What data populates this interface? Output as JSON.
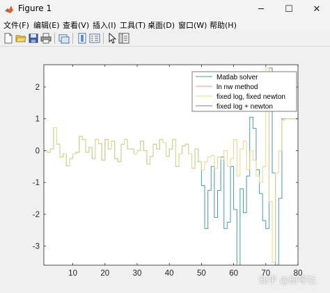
{
  "window": {
    "title": "Figure 1",
    "controls": {
      "minimize": "─",
      "maximize": "☐",
      "close": "✕"
    }
  },
  "menu": [
    {
      "label": "文件(F)"
    },
    {
      "label": "编辑(E)"
    },
    {
      "label": "查看(V)"
    },
    {
      "label": "插入(I)"
    },
    {
      "label": "工具(T)"
    },
    {
      "label": "桌面(D)"
    },
    {
      "label": "窗口(W)"
    },
    {
      "label": "帮助(H)"
    }
  ],
  "toolbar": {
    "icons": [
      "new-figure-icon",
      "open-file-icon",
      "save-icon",
      "print-icon",
      "link-plot-icon",
      "insert-colorbar-icon",
      "insert-legend-icon",
      "edit-plot-icon",
      "property-editor-icon"
    ]
  },
  "colors": {
    "matlab_solver": "#4a9aa8",
    "ln_nw": "#e89a76",
    "fixed_log_fixed_newton": "#e3d98a",
    "fixed_log_newton": "#808080"
  },
  "watermark": "知乎 @研导社",
  "chart_data": {
    "type": "line",
    "style": "stairs",
    "xlim": [
      1,
      80
    ],
    "ylim": [
      -3.6,
      2.7
    ],
    "xticks": [
      10,
      20,
      30,
      40,
      50,
      60,
      70,
      80
    ],
    "yticks": [
      2,
      1,
      0,
      -1,
      -2,
      -3
    ],
    "grid": false,
    "legend_position": "top-right",
    "series": [
      {
        "name": "Matlab solver",
        "color": "#4a9aa8",
        "x": [
          1,
          2,
          3,
          4,
          5,
          6,
          7,
          8,
          9,
          10,
          11,
          12,
          13,
          14,
          15,
          16,
          17,
          18,
          19,
          20,
          21,
          22,
          23,
          24,
          25,
          26,
          27,
          28,
          29,
          30,
          31,
          32,
          33,
          34,
          35,
          36,
          37,
          38,
          39,
          40,
          41,
          42,
          43,
          44,
          45,
          46,
          47,
          48,
          49,
          50,
          51,
          52,
          53,
          54,
          55,
          56,
          57,
          58,
          59,
          60,
          61,
          62,
          63,
          64,
          65,
          66,
          67,
          68,
          69,
          70,
          71,
          72,
          73,
          74,
          75,
          76,
          77,
          78,
          79,
          80
        ],
        "y": [
          0.0,
          -0.05,
          0.05,
          0.72,
          0.2,
          -0.2,
          -0.1,
          -0.48,
          -0.25,
          -0.1,
          -0.05,
          0.45,
          0.35,
          -0.05,
          0.1,
          -0.25,
          0.35,
          0.22,
          -0.3,
          0.35,
          0.05,
          0.3,
          -0.25,
          -0.35,
          0.2,
          0.35,
          0.05,
          0.05,
          -0.1,
          0.0,
          0.3,
          0.0,
          -0.42,
          -0.18,
          0.2,
          0.05,
          0.35,
          0.25,
          -0.18,
          0.05,
          0.35,
          -0.5,
          -0.1,
          0.15,
          0.2,
          -0.1,
          -0.55,
          0.05,
          -0.35,
          -1.1,
          -2.45,
          -1.25,
          -0.5,
          -2.1,
          -1.25,
          -0.2,
          -2.45,
          -2.25,
          -0.5,
          -1.85,
          -3.6,
          -1.2,
          -1.95,
          -0.8,
          1.05,
          0.7,
          -0.6,
          -1.35,
          -2.2,
          -2.45,
          2.6,
          -0.7,
          -3.6,
          -1.5,
          1.0,
          1.0,
          1.0,
          1.0,
          1.0,
          1.0
        ]
      },
      {
        "name": "ln nw method",
        "color": "#e89a76",
        "x": [
          1,
          80
        ],
        "y": [
          0.0,
          0.0
        ],
        "draw": false
      },
      {
        "name": "fixed log, fixed newton",
        "color": "#e3d98a",
        "x": [
          1,
          2,
          3,
          4,
          5,
          6,
          7,
          8,
          9,
          10,
          11,
          12,
          13,
          14,
          15,
          16,
          17,
          18,
          19,
          20,
          21,
          22,
          23,
          24,
          25,
          26,
          27,
          28,
          29,
          30,
          31,
          32,
          33,
          34,
          35,
          36,
          37,
          38,
          39,
          40,
          41,
          42,
          43,
          44,
          45,
          46,
          47,
          48,
          49,
          50,
          51,
          52,
          53,
          54,
          55,
          56,
          57,
          58,
          59,
          60,
          61,
          62,
          63,
          64,
          65,
          66,
          67,
          68,
          69,
          70,
          71,
          72,
          73,
          74,
          75,
          76,
          77,
          78,
          79,
          80
        ],
        "y": [
          0.0,
          -0.05,
          0.05,
          0.72,
          0.2,
          -0.2,
          -0.1,
          -0.48,
          -0.25,
          -0.1,
          -0.05,
          0.45,
          0.35,
          -0.05,
          0.1,
          -0.25,
          0.35,
          0.22,
          -0.3,
          0.35,
          0.05,
          0.3,
          -0.25,
          -0.35,
          0.2,
          0.35,
          0.05,
          0.05,
          -0.1,
          0.0,
          0.3,
          0.0,
          -0.42,
          -0.18,
          0.2,
          0.05,
          0.35,
          0.25,
          -0.18,
          0.05,
          0.35,
          -0.5,
          -0.1,
          0.15,
          0.2,
          -0.1,
          -0.55,
          0.05,
          -0.35,
          -0.6,
          -0.35,
          -0.2,
          -0.15,
          -0.55,
          -0.2,
          -0.3,
          0.0,
          -0.5,
          -0.25,
          0.35,
          -0.8,
          0.05,
          0.3,
          -0.6,
          0.0,
          -0.3,
          -0.8,
          -1.0,
          -0.5,
          2.6,
          -1.6,
          -3.5,
          -0.7,
          0.0,
          0.95,
          1.0,
          1.0,
          1.0,
          1.0,
          1.0
        ]
      },
      {
        "name": "fixed log + newton",
        "color": "#808080",
        "x": [
          1,
          80
        ],
        "y": [
          0.0,
          0.0
        ],
        "draw": false
      }
    ]
  }
}
